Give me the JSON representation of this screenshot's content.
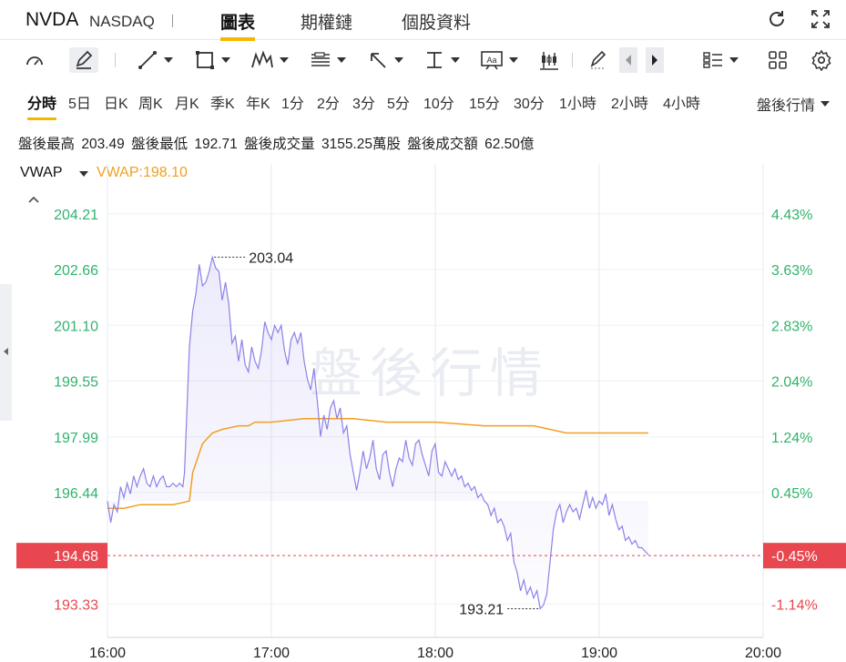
{
  "header": {
    "ticker": "NVDA",
    "exchange": "NASDAQ",
    "tabs": [
      "圖表",
      "期權鏈",
      "個股資料"
    ],
    "active_tab": "圖表"
  },
  "toolbar": {
    "icons": [
      "gauge-icon",
      "pen-edit-icon",
      "trend-line-icon",
      "rectangle-icon",
      "pattern-icon",
      "fib-icon",
      "arrow-icon",
      "measure-icon",
      "text-icon",
      "candle-icon",
      "brush-icon",
      "prev-icon",
      "next-icon",
      "list-icon",
      "grid-icon",
      "settings-icon"
    ]
  },
  "periods": {
    "items": [
      "分時",
      "5日",
      "日K",
      "周K",
      "月K",
      "季K",
      "年K",
      "1分",
      "2分",
      "3分",
      "5分",
      "10分",
      "15分",
      "30分",
      "1小時",
      "2小時",
      "4小時"
    ],
    "active": "分時",
    "session_label": "盤後行情"
  },
  "summary": {
    "high_label": "盤後最高",
    "high_value": "203.49",
    "low_label": "盤後最低",
    "low_value": "192.71",
    "volume_label": "盤後成交量",
    "volume_value": "3155.25萬股",
    "amount_label": "盤後成交額",
    "amount_value": "62.50億"
  },
  "indicator": {
    "name": "VWAP",
    "value_text": "VWAP:198.10"
  },
  "colors": {
    "price_line": "#8b82e8",
    "vwap_line": "#f0a020",
    "up": "#2fb36b",
    "down": "#e8474f",
    "accent": "#f5b800"
  },
  "chart_data": {
    "type": "line",
    "watermark": "盤後行情",
    "y_left_ticks": [
      "204.21",
      "202.66",
      "201.10",
      "199.55",
      "197.99",
      "196.44",
      "193.33"
    ],
    "y_right_ticks": [
      "4.43%",
      "3.63%",
      "2.83%",
      "2.04%",
      "1.24%",
      "0.45%",
      "-1.14%"
    ],
    "current_price": "194.68",
    "current_change": "-0.45%",
    "x_ticks": [
      "16:00",
      "17:00",
      "18:00",
      "19:00",
      "20:00"
    ],
    "high_annotation": "203.04",
    "low_annotation": "193.21",
    "ylim": [
      192.4,
      205.6
    ],
    "xlim_hours": [
      16,
      20
    ],
    "series": [
      {
        "name": "price",
        "points": [
          [
            16.0,
            196.2
          ],
          [
            16.02,
            195.6
          ],
          [
            16.04,
            196.1
          ],
          [
            16.06,
            195.9
          ],
          [
            16.08,
            196.6
          ],
          [
            16.1,
            196.3
          ],
          [
            16.12,
            196.7
          ],
          [
            16.14,
            196.4
          ],
          [
            16.16,
            196.9
          ],
          [
            16.18,
            196.6
          ],
          [
            16.2,
            196.9
          ],
          [
            16.22,
            197.1
          ],
          [
            16.24,
            196.7
          ],
          [
            16.26,
            196.6
          ],
          [
            16.28,
            196.9
          ],
          [
            16.3,
            196.6
          ],
          [
            16.32,
            196.8
          ],
          [
            16.34,
            196.9
          ],
          [
            16.36,
            196.6
          ],
          [
            16.38,
            196.6
          ],
          [
            16.4,
            196.7
          ],
          [
            16.42,
            196.6
          ],
          [
            16.44,
            196.7
          ],
          [
            16.46,
            196.6
          ],
          [
            16.47,
            197.0
          ],
          [
            16.5,
            200.5
          ],
          [
            16.52,
            201.5
          ],
          [
            16.54,
            202.0
          ],
          [
            16.56,
            202.8
          ],
          [
            16.58,
            202.2
          ],
          [
            16.6,
            202.3
          ],
          [
            16.62,
            202.6
          ],
          [
            16.64,
            203.0
          ],
          [
            16.66,
            202.7
          ],
          [
            16.68,
            202.6
          ],
          [
            16.7,
            201.8
          ],
          [
            16.72,
            202.3
          ],
          [
            16.74,
            201.7
          ],
          [
            16.76,
            200.6
          ],
          [
            16.78,
            200.8
          ],
          [
            16.8,
            200.1
          ],
          [
            16.82,
            200.7
          ],
          [
            16.84,
            200.0
          ],
          [
            16.86,
            199.8
          ],
          [
            16.88,
            200.5
          ],
          [
            16.9,
            200.1
          ],
          [
            16.92,
            199.9
          ],
          [
            16.94,
            200.4
          ],
          [
            16.96,
            201.2
          ],
          [
            16.98,
            200.9
          ],
          [
            17.0,
            200.7
          ],
          [
            17.02,
            201.1
          ],
          [
            17.04,
            200.9
          ],
          [
            17.06,
            201.1
          ],
          [
            17.08,
            200.4
          ],
          [
            17.1,
            200.0
          ],
          [
            17.12,
            200.7
          ],
          [
            17.14,
            200.9
          ],
          [
            17.16,
            200.6
          ],
          [
            17.18,
            200.9
          ],
          [
            17.2,
            200.1
          ],
          [
            17.22,
            199.6
          ],
          [
            17.24,
            199.3
          ],
          [
            17.26,
            199.9
          ],
          [
            17.28,
            199.0
          ],
          [
            17.3,
            198.0
          ],
          [
            17.32,
            198.6
          ],
          [
            17.34,
            198.2
          ],
          [
            17.36,
            198.8
          ],
          [
            17.38,
            199.0
          ],
          [
            17.4,
            198.5
          ],
          [
            17.42,
            198.8
          ],
          [
            17.44,
            198.1
          ],
          [
            17.46,
            198.3
          ],
          [
            17.48,
            197.5
          ],
          [
            17.5,
            197.0
          ],
          [
            17.52,
            196.5
          ],
          [
            17.54,
            197.0
          ],
          [
            17.56,
            197.6
          ],
          [
            17.58,
            197.1
          ],
          [
            17.6,
            197.4
          ],
          [
            17.62,
            197.9
          ],
          [
            17.64,
            197.1
          ],
          [
            17.66,
            196.8
          ],
          [
            17.68,
            197.5
          ],
          [
            17.7,
            197.6
          ],
          [
            17.72,
            197.0
          ],
          [
            17.74,
            196.6
          ],
          [
            17.76,
            197.1
          ],
          [
            17.78,
            197.4
          ],
          [
            17.8,
            197.3
          ],
          [
            17.82,
            197.9
          ],
          [
            17.84,
            197.4
          ],
          [
            17.86,
            197.2
          ],
          [
            17.88,
            197.8
          ],
          [
            17.9,
            197.9
          ],
          [
            17.92,
            197.5
          ],
          [
            17.94,
            197.2
          ],
          [
            17.96,
            196.9
          ],
          [
            17.98,
            197.6
          ],
          [
            18.0,
            197.8
          ],
          [
            18.02,
            197.0
          ],
          [
            18.04,
            196.9
          ],
          [
            18.06,
            197.3
          ],
          [
            18.08,
            197.1
          ],
          [
            18.1,
            196.9
          ],
          [
            18.12,
            197.1
          ],
          [
            18.14,
            196.8
          ],
          [
            18.16,
            196.9
          ],
          [
            18.18,
            196.6
          ],
          [
            18.2,
            196.7
          ],
          [
            18.22,
            196.5
          ],
          [
            18.24,
            196.6
          ],
          [
            18.26,
            196.3
          ],
          [
            18.28,
            196.4
          ],
          [
            18.3,
            196.2
          ],
          [
            18.32,
            196.1
          ],
          [
            18.34,
            195.8
          ],
          [
            18.36,
            196.0
          ],
          [
            18.38,
            195.6
          ],
          [
            18.4,
            195.7
          ],
          [
            18.42,
            195.5
          ],
          [
            18.44,
            195.1
          ],
          [
            18.46,
            195.3
          ],
          [
            18.48,
            194.5
          ],
          [
            18.5,
            194.2
          ],
          [
            18.52,
            193.7
          ],
          [
            18.54,
            194.0
          ],
          [
            18.56,
            193.6
          ],
          [
            18.58,
            193.8
          ],
          [
            18.6,
            193.5
          ],
          [
            18.62,
            193.7
          ],
          [
            18.64,
            193.2
          ],
          [
            18.66,
            193.3
          ],
          [
            18.68,
            193.6
          ],
          [
            18.7,
            194.5
          ],
          [
            18.72,
            195.4
          ],
          [
            18.74,
            195.9
          ],
          [
            18.76,
            196.1
          ],
          [
            18.78,
            195.6
          ],
          [
            18.8,
            195.9
          ],
          [
            18.82,
            196.1
          ],
          [
            18.84,
            195.9
          ],
          [
            18.86,
            196.0
          ],
          [
            18.88,
            195.7
          ],
          [
            18.9,
            196.1
          ],
          [
            18.92,
            196.5
          ],
          [
            18.94,
            196.0
          ],
          [
            18.96,
            196.3
          ],
          [
            18.98,
            196.0
          ],
          [
            19.0,
            196.2
          ],
          [
            19.02,
            196.1
          ],
          [
            19.04,
            196.4
          ],
          [
            19.06,
            195.8
          ],
          [
            19.08,
            196.1
          ],
          [
            19.1,
            195.7
          ],
          [
            19.12,
            195.4
          ],
          [
            19.14,
            195.5
          ],
          [
            19.16,
            195.1
          ],
          [
            19.18,
            195.2
          ],
          [
            19.2,
            195.0
          ],
          [
            19.22,
            195.1
          ],
          [
            19.24,
            194.9
          ],
          [
            19.26,
            194.9
          ],
          [
            19.28,
            194.8
          ],
          [
            19.3,
            194.7
          ]
        ]
      },
      {
        "name": "VWAP",
        "points": [
          [
            16.0,
            196.0
          ],
          [
            16.1,
            196.0
          ],
          [
            16.2,
            196.1
          ],
          [
            16.3,
            196.1
          ],
          [
            16.4,
            196.1
          ],
          [
            16.5,
            196.2
          ],
          [
            16.52,
            197.0
          ],
          [
            16.58,
            197.8
          ],
          [
            16.64,
            198.1
          ],
          [
            16.7,
            198.2
          ],
          [
            16.8,
            198.3
          ],
          [
            16.86,
            198.3
          ],
          [
            16.9,
            198.4
          ],
          [
            17.0,
            198.4
          ],
          [
            17.2,
            198.5
          ],
          [
            17.4,
            198.5
          ],
          [
            17.5,
            198.5
          ],
          [
            17.7,
            198.4
          ],
          [
            18.0,
            198.4
          ],
          [
            18.3,
            198.3
          ],
          [
            18.6,
            198.3
          ],
          [
            18.8,
            198.1
          ],
          [
            19.0,
            198.1
          ],
          [
            19.2,
            198.1
          ],
          [
            19.3,
            198.1
          ]
        ]
      }
    ]
  }
}
